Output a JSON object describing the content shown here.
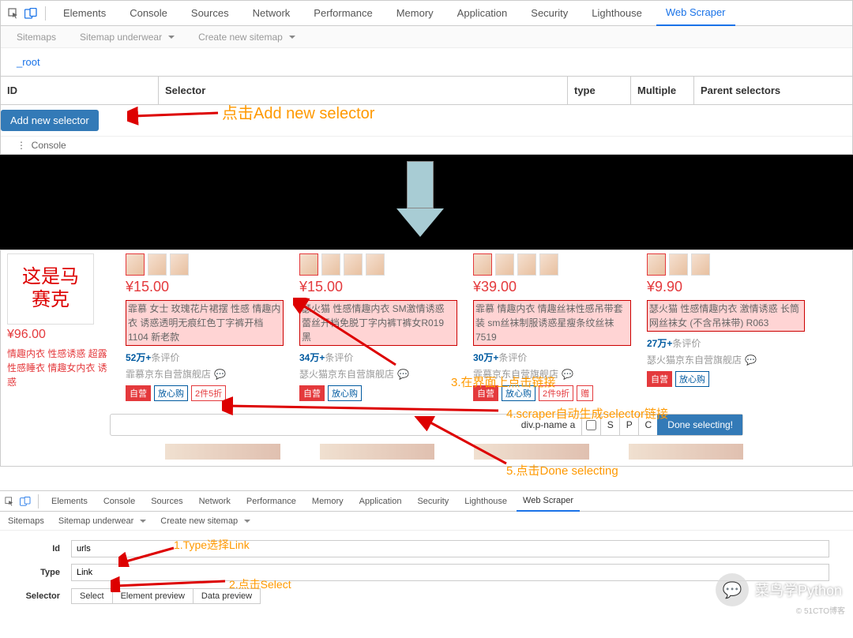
{
  "devtools": {
    "tabs": [
      "Elements",
      "Console",
      "Sources",
      "Network",
      "Performance",
      "Memory",
      "Application",
      "Security",
      "Lighthouse",
      "Web Scraper"
    ],
    "active_tab": "Web Scraper",
    "subnav": {
      "sitemaps": "Sitemaps",
      "current": "Sitemap underwear",
      "create": "Create new sitemap"
    },
    "breadcrumb": "_root",
    "table_headers": {
      "id": "ID",
      "selector": "Selector",
      "type": "type",
      "multiple": "Multiple",
      "parent": "Parent selectors"
    },
    "add_button": "Add new selector",
    "console_label": "Console"
  },
  "annotations": {
    "add": "点击Add new selector",
    "step3": "3.在界面上点击链接",
    "step4": "4.scraper自动生成selector链接",
    "step5": "5.点击Done selecting",
    "step1b": "1.Type选择Link",
    "step2b": "2.点击Select"
  },
  "mosaic": "这是马\n赛克",
  "products": [
    {
      "price": "¥96.00",
      "desc_plain": "情趣内衣 性感诱惑 超露 性感睡衣 情趣女内衣 诱惑"
    },
    {
      "price": "¥15.00",
      "desc_hl": "霏慕 女士 玫瑰花片裙摆 性感 情趣内衣 诱惑透明无痕红色丁字裤开档1104 新老款",
      "reviews_num": "52万+",
      "reviews_txt": "条评价",
      "shop": "霏慕京东自营旗舰店",
      "tags": [
        "自营",
        "放心购",
        "2件5折"
      ]
    },
    {
      "price": "¥15.00",
      "desc_hl": "瑟火猫 性感情趣内衣 SM激情诱惑 蕾丝开档免脱丁字内裤T裤女R019 黑",
      "reviews_num": "34万+",
      "reviews_txt": "条评价",
      "shop": "瑟火猫京东自营旗舰店",
      "tags": [
        "自营",
        "放心购"
      ]
    },
    {
      "price": "¥39.00",
      "desc_hl": "霏慕 情趣内衣 情趣丝袜性感吊带套装 sm丝袜制服诱惑星瘦条纹丝袜7519",
      "reviews_num": "30万+",
      "reviews_txt": "条评价",
      "shop": "霏慕京东自营旗舰店",
      "tags": [
        "自营",
        "放心购",
        "2件9折",
        "赠"
      ]
    },
    {
      "price": "¥9.90",
      "desc_hl": "瑟火猫 性感情趣内衣 激情诱惑 长筒网丝袜女 (不含吊袜带) R063",
      "reviews_num": "27万+",
      "reviews_txt": "条评价",
      "shop": "瑟火猫京东自营旗舰店",
      "tags": [
        "自营",
        "放心购"
      ]
    }
  ],
  "selector_bar": {
    "value": "div.p-name a",
    "buttons": {
      "s": "S",
      "p": "P",
      "c": "C"
    },
    "done": "Done selecting!"
  },
  "bottom_form": {
    "labels": {
      "id": "Id",
      "type": "Type",
      "selector": "Selector"
    },
    "values": {
      "id": "urls",
      "type": "Link"
    },
    "buttons": {
      "select": "Select",
      "element_preview": "Element preview",
      "data_preview": "Data preview"
    }
  },
  "watermark": {
    "name": "菜鸟学Python",
    "credit": "© 51CTO博客"
  }
}
